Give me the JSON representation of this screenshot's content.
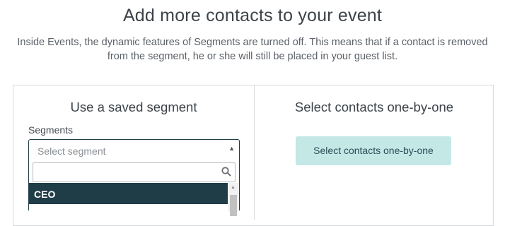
{
  "header": {
    "title": "Add more contacts to your event",
    "description_line1": "Inside Events, the dynamic features of Segments are turned off. This means that if a contact is removed",
    "description_line2": "from the segment, he or she will still be placed in your guest list."
  },
  "left_panel": {
    "title": "Use a saved segment",
    "field_label": "Segments",
    "select": {
      "placeholder": "Select segment",
      "search_value": "",
      "options": [
        "CEO"
      ],
      "highlighted_option": "CEO"
    }
  },
  "right_panel": {
    "title": "Select contacts one-by-one",
    "button_label": "Select contacts one-by-one"
  },
  "icons": {
    "select_caret": "caret-up-icon",
    "search": "search-icon",
    "scroll_up": "scroll-up-arrow-icon"
  },
  "colors": {
    "highlight_bg": "#1f3d47",
    "button_bg": "#c3e8e6",
    "button_text": "#2b4c57"
  }
}
